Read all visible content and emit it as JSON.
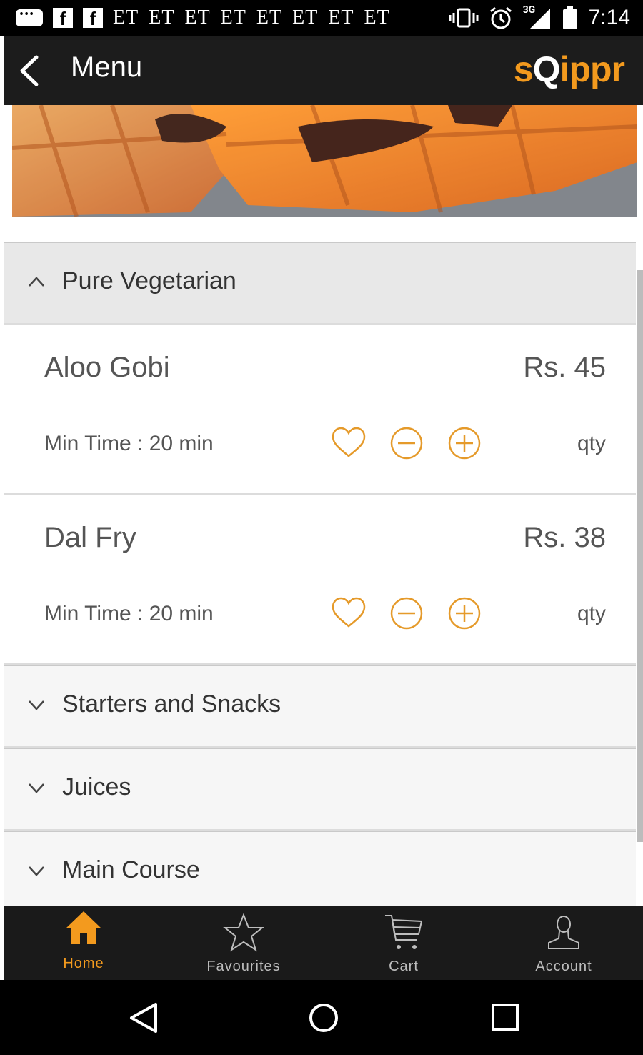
{
  "status_bar": {
    "notification_texts": [
      "ET",
      "ET",
      "ET",
      "ET",
      "ET",
      "ET",
      "ET",
      "ET"
    ],
    "network": "3G",
    "time": "7:14"
  },
  "app_bar": {
    "title": "Menu",
    "brand_prefix": "s",
    "brand_q": "Q",
    "brand_suffix": "ippr"
  },
  "categories": [
    {
      "label": "Pure Vegetarian",
      "expanded": true,
      "items": [
        {
          "name": "Aloo Gobi",
          "price": "Rs. 45",
          "min_time": "Min Time : 20 min",
          "qty_label": "qty"
        },
        {
          "name": "Dal Fry",
          "price": "Rs. 38",
          "min_time": "Min Time : 20 min",
          "qty_label": "qty"
        }
      ]
    },
    {
      "label": "Starters and Snacks",
      "expanded": false
    },
    {
      "label": "Juices",
      "expanded": false
    },
    {
      "label": "Main Course",
      "expanded": false
    }
  ],
  "bottom_nav": {
    "items": [
      {
        "label": "Home",
        "icon": "home-icon",
        "active": true
      },
      {
        "label": "Favourites",
        "icon": "star-icon",
        "active": false
      },
      {
        "label": "Cart",
        "icon": "cart-icon",
        "active": false
      },
      {
        "label": "Account",
        "icon": "account-icon",
        "active": false
      }
    ]
  },
  "colors": {
    "accent": "#f39a1e",
    "app_bar": "#1c1c1c",
    "category_expanded_bg": "#e8e8e8",
    "category_collapsed_bg": "#f6f6f6"
  }
}
